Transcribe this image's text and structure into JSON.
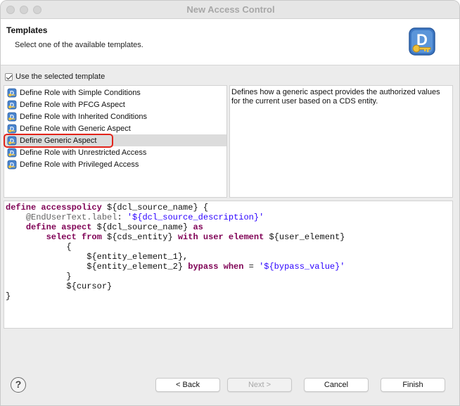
{
  "window": {
    "title": "New Access Control"
  },
  "header": {
    "title": "Templates",
    "description": "Select one of the available templates."
  },
  "use_template": {
    "label": "Use the selected template",
    "checked": true
  },
  "templates": [
    {
      "label": "Define Role with Simple Conditions",
      "selected": false
    },
    {
      "label": "Define Role with PFCG Aspect",
      "selected": false
    },
    {
      "label": "Define Role with Inherited Conditions",
      "selected": false
    },
    {
      "label": "Define Role with Generic Aspect",
      "selected": false
    },
    {
      "label": "Define Generic Aspect",
      "selected": true
    },
    {
      "label": "Define Role with Unrestricted Access",
      "selected": false
    },
    {
      "label": "Define Role with Privileged Access",
      "selected": false
    }
  ],
  "description_text": "Defines how a generic aspect provides the authorized values for the current user based on a CDS entity.",
  "code": {
    "lines": [
      [
        {
          "t": "kw",
          "v": "define accesspolicy"
        },
        {
          "t": "pl",
          "v": " ${dcl_source_name} {"
        }
      ],
      [
        {
          "t": "pl",
          "v": "    "
        },
        {
          "t": "ann",
          "v": "@EndUserText.label"
        },
        {
          "t": "pl",
          "v": ": "
        },
        {
          "t": "str",
          "v": "'${dcl_source_description}'"
        }
      ],
      [
        {
          "t": "pl",
          "v": "    "
        },
        {
          "t": "kw",
          "v": "define aspect"
        },
        {
          "t": "pl",
          "v": " ${dcl_source_name} "
        },
        {
          "t": "kw",
          "v": "as"
        }
      ],
      [
        {
          "t": "pl",
          "v": "        "
        },
        {
          "t": "kw",
          "v": "select from"
        },
        {
          "t": "pl",
          "v": " ${cds_entity} "
        },
        {
          "t": "kw",
          "v": "with user element"
        },
        {
          "t": "pl",
          "v": " ${user_element}"
        }
      ],
      [
        {
          "t": "pl",
          "v": "            {"
        }
      ],
      [
        {
          "t": "pl",
          "v": "                ${entity_element_1},"
        }
      ],
      [
        {
          "t": "pl",
          "v": "                ${entity_element_2} "
        },
        {
          "t": "kw",
          "v": "bypass when"
        },
        {
          "t": "pl",
          "v": " = "
        },
        {
          "t": "str",
          "v": "'${bypass_value}'"
        }
      ],
      [
        {
          "t": "pl",
          "v": "            }"
        }
      ],
      [
        {
          "t": "pl",
          "v": "            ${cursor}"
        }
      ],
      [
        {
          "t": "pl",
          "v": "}"
        }
      ]
    ]
  },
  "buttons": {
    "help": "?",
    "back": "< Back",
    "next": "Next >",
    "cancel": "Cancel",
    "finish": "Finish"
  },
  "colors": {
    "keyword": "#7f0055",
    "string": "#2a00ff",
    "annotation": "#646464",
    "highlight": "#e2231a"
  }
}
